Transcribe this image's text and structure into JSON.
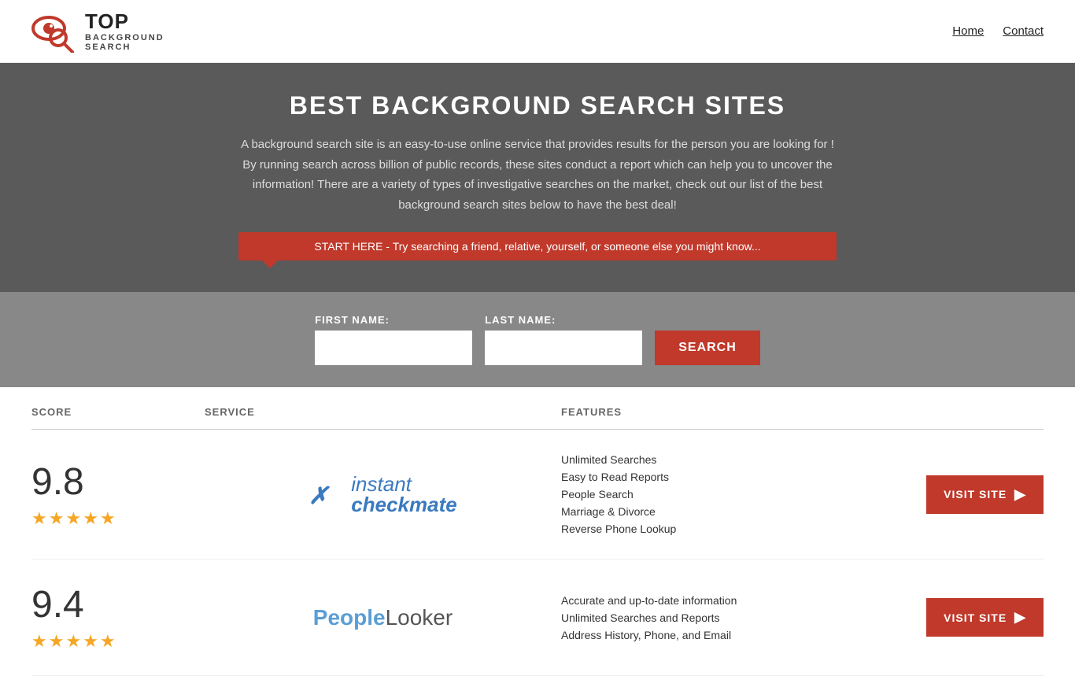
{
  "header": {
    "logo_top": "TOP",
    "logo_sub": "BACKGROUND\nSEARCH",
    "nav": {
      "home_label": "Home",
      "contact_label": "Contact"
    }
  },
  "hero": {
    "title": "BEST BACKGROUND SEARCH SITES",
    "description": "A background search site is an easy-to-use online service that provides results  for the person you are looking for ! By  running  search across billion of public records, these sites conduct  a report which can help you to uncover the information! There are a variety of types of investigative searches on the market, check out our  list of the best background search sites below to have the best deal!",
    "banner_text": "START HERE - Try searching a friend, relative, yourself, or someone else you might know..."
  },
  "search": {
    "first_name_label": "FIRST NAME:",
    "last_name_label": "LAST NAME:",
    "button_label": "SEARCH"
  },
  "table": {
    "headers": {
      "score": "SCORE",
      "service": "SERVICE",
      "features": "FEATURES",
      "action": ""
    },
    "rows": [
      {
        "score": "9.8",
        "stars": 5,
        "service_name": "Instant Checkmate",
        "features": [
          "Unlimited Searches",
          "Easy to Read Reports",
          "People Search",
          "Marriage & Divorce",
          "Reverse Phone Lookup"
        ],
        "visit_label": "VISIT SITE"
      },
      {
        "score": "9.4",
        "stars": 5,
        "service_name": "PeopleLooker",
        "features": [
          "Accurate and up-to-date information",
          "Unlimited Searches and Reports",
          "Address History, Phone, and Email"
        ],
        "visit_label": "VISIT SITE"
      }
    ]
  },
  "colors": {
    "primary_red": "#c0392b",
    "star_gold": "#f5a623",
    "checkmate_blue": "#3a7abf",
    "people_blue": "#5a9ed6"
  }
}
